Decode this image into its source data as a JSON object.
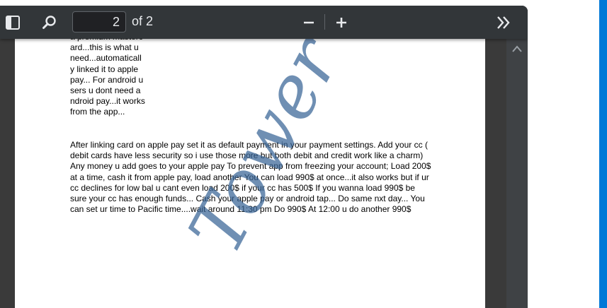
{
  "toolbar": {
    "sidebar_icon": "sidebar-toggle-icon",
    "search_icon": "search-icon",
    "page_number": "2",
    "page_of": "of 2",
    "zoom_out_icon": "minus-icon",
    "zoom_in_icon": "plus-icon",
    "more_icon": "double-chevron-right-icon"
  },
  "document": {
    "narrow_text": "a premium mastercard...this is what u need...automatically linked it to apple pay... For android users u dont need android pay...it works from the app...",
    "body_text": "After linking card on apple pay set it as default payment in your payment settings. Add your cc ( debit cards have less security so i use those more but both debit and credit work like a charm) Any money u add goes to your apple pay To prevent app from freezing your account; Load 200$ at a time, cash it from apple pay, load another You can load 990$ at once...it also works but if ur cc declines for low bal u cant even load 200$ if your cc has 500$ If you wanna load 990$ be sure your cc has enough funds... Cash your apple pay or android tap... Do same nxt day... You can set ur time to Pacific time....wait around 11:30 pm Do 990$ At 12:00 u do another 990$",
    "watermark": "Tower"
  },
  "colors": {
    "toolbar_bg": "#323639",
    "watermark": "#3a6696",
    "accent": "#0078d7"
  }
}
